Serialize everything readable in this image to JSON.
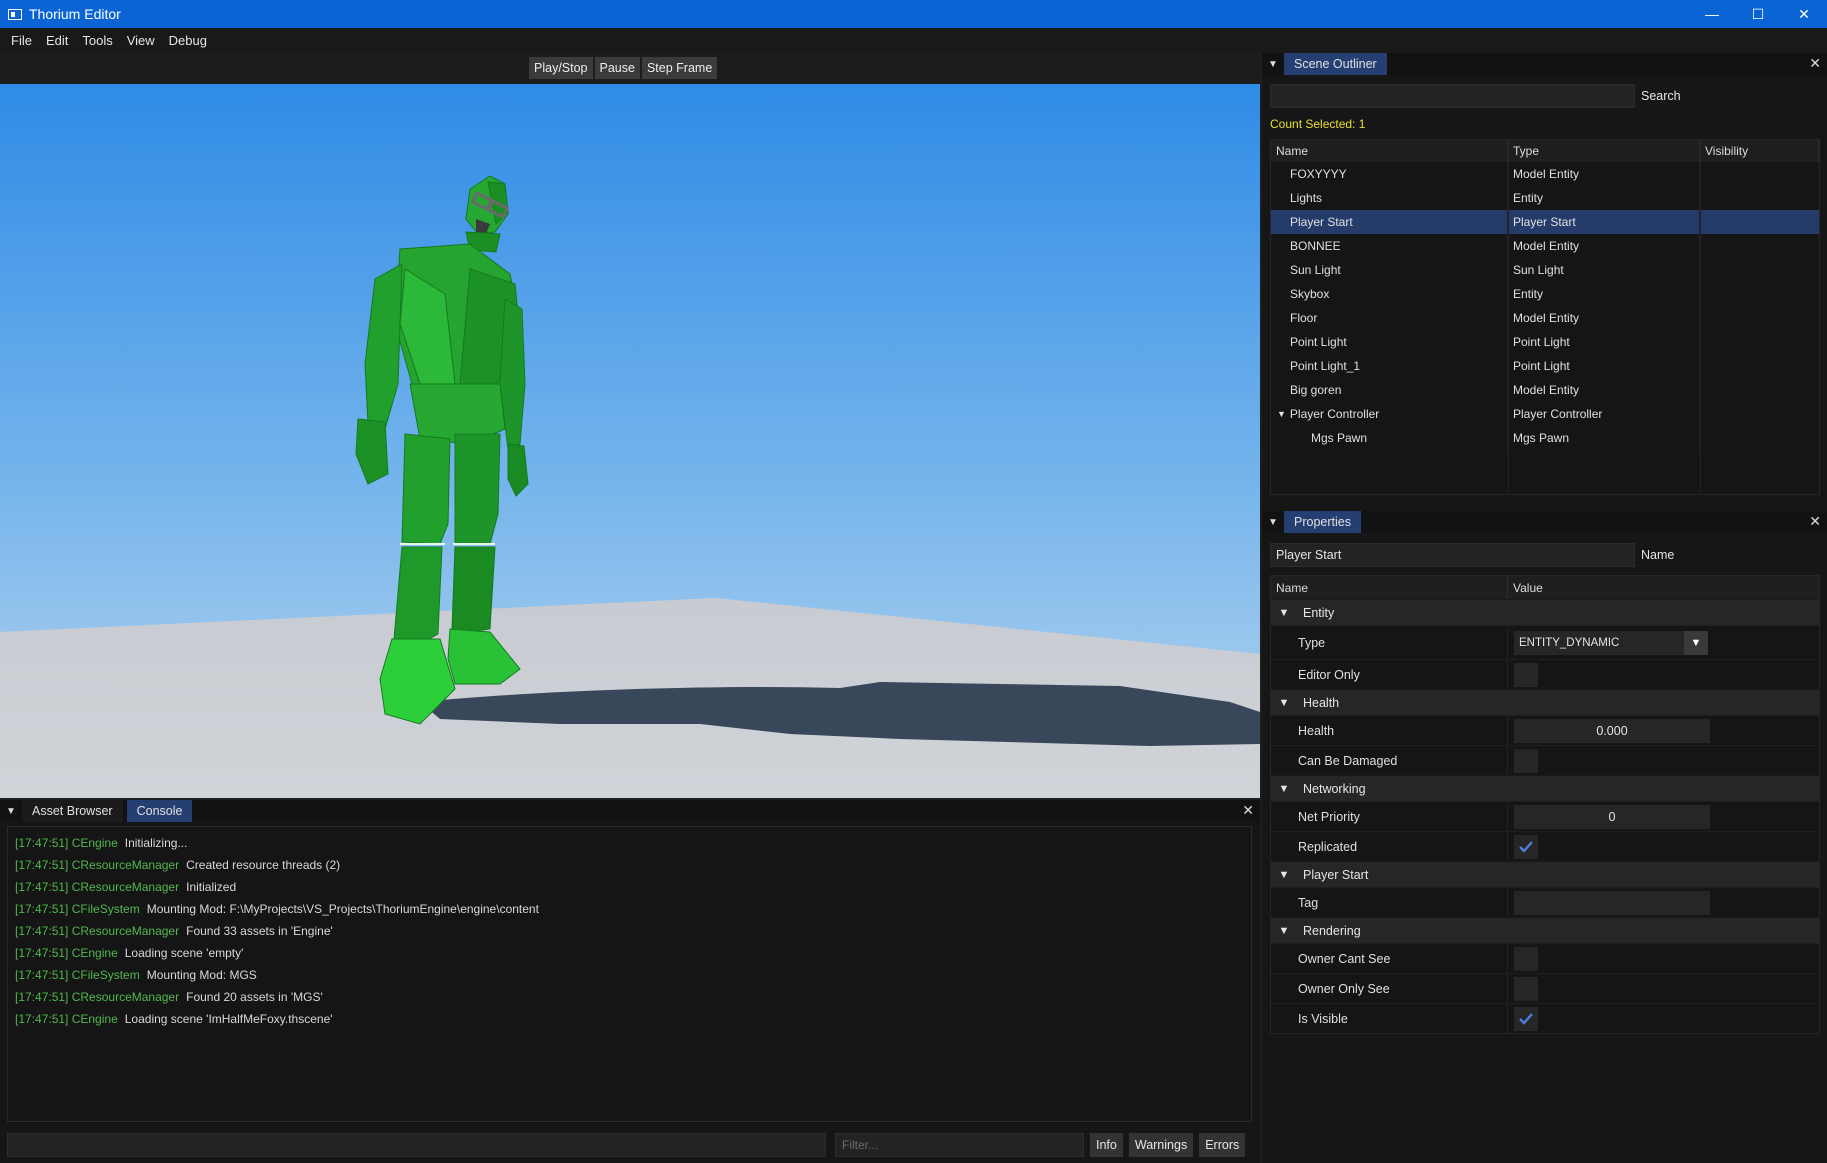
{
  "window": {
    "title": "Thorium Editor",
    "minimize": "—",
    "maximize": "☐",
    "close": "✕"
  },
  "menu": [
    "File",
    "Edit",
    "Tools",
    "View",
    "Debug"
  ],
  "viewport": {
    "buttons": [
      "Play/Stop",
      "Pause",
      "Step Frame"
    ]
  },
  "bottom_panel": {
    "tabs": [
      "Asset Browser",
      "Console"
    ],
    "active_tab": "Console",
    "log": [
      {
        "source": "[17:47:51] CEngine",
        "message": "Initializing..."
      },
      {
        "source": "[17:47:51] CResourceManager",
        "message": "Created resource threads (2)"
      },
      {
        "source": "[17:47:51] CResourceManager",
        "message": "Initialized"
      },
      {
        "source": "[17:47:51] CFileSystem",
        "message": "Mounting Mod: F:\\MyProjects\\VS_Projects\\ThoriumEngine\\engine\\content"
      },
      {
        "source": "[17:47:51] CResourceManager",
        "message": "Found 33 assets in 'Engine'"
      },
      {
        "source": "[17:47:51] CEngine",
        "message": "Loading scene 'empty'"
      },
      {
        "source": "[17:47:51] CFileSystem",
        "message": "Mounting Mod: MGS"
      },
      {
        "source": "[17:47:51] CResourceManager",
        "message": "Found 20 assets in 'MGS'"
      },
      {
        "source": "[17:47:51] CEngine",
        "message": "Loading scene 'ImHalfMeFoxy.thscene'"
      }
    ],
    "filter_placeholder": "Filter...",
    "buttons": [
      "Info",
      "Warnings",
      "Errors"
    ]
  },
  "outliner": {
    "tab": "Scene Outliner",
    "search_label": "Search",
    "count_selected": "Count Selected: 1",
    "columns": [
      "Name",
      "Type",
      "Visibility"
    ],
    "rows": [
      {
        "name": "FOXYYYY",
        "type": "Model Entity"
      },
      {
        "name": "Lights",
        "type": "Entity"
      },
      {
        "name": "Player Start",
        "type": "Player Start"
      },
      {
        "name": "BONNEE",
        "type": "Model Entity"
      },
      {
        "name": "Sun Light",
        "type": "Sun Light"
      },
      {
        "name": "Skybox",
        "type": "Entity"
      },
      {
        "name": "Floor",
        "type": "Model Entity"
      },
      {
        "name": "Point Light",
        "type": "Point Light"
      },
      {
        "name": "Point Light_1",
        "type": "Point Light"
      },
      {
        "name": "Big goren",
        "type": "Model Entity"
      },
      {
        "name": "Player Controller",
        "type": "Player Controller"
      },
      {
        "name": "Mgs Pawn",
        "type": "Mgs Pawn"
      }
    ],
    "selected": "Player Start"
  },
  "properties": {
    "tab": "Properties",
    "entity_name": "Player Start",
    "name_label": "Name",
    "columns": [
      "Name",
      "Value"
    ],
    "groups": {
      "entity": "Entity",
      "health": "Health",
      "networking": "Networking",
      "player_start": "Player Start",
      "rendering": "Rendering"
    },
    "fields": {
      "type_label": "Type",
      "type_value": "ENTITY_DYNAMIC",
      "editor_only_label": "Editor Only",
      "editor_only": false,
      "health_label": "Health",
      "health_value": "0.000",
      "can_be_damaged_label": "Can Be Damaged",
      "can_be_damaged": false,
      "net_priority_label": "Net Priority",
      "net_priority_value": "0",
      "replicated_label": "Replicated",
      "replicated": true,
      "tag_label": "Tag",
      "tag_value": "",
      "owner_cant_see_label": "Owner Cant See",
      "owner_cant_see": false,
      "owner_only_see_label": "Owner Only See",
      "owner_only_see": false,
      "is_visible_label": "Is Visible",
      "is_visible": true
    }
  },
  "colors": {
    "titlebar": "#0a64d4",
    "active_tab": "#263f73",
    "selected_row": "#253c6b",
    "log_source": "#51b84f",
    "count_selected": "#e8e030",
    "check": "#4e7fe0"
  }
}
